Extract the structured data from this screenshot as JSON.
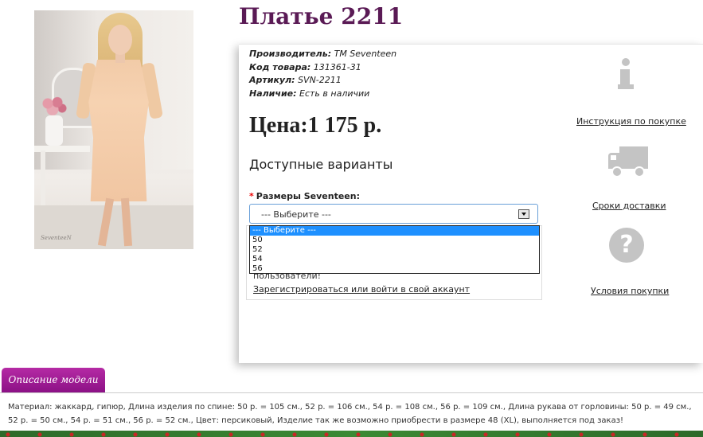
{
  "product": {
    "title": "Платье 2211",
    "photo_signature": "SeventeeN"
  },
  "meta": {
    "manufacturer_label": "Производитель:",
    "manufacturer_value": "ТМ Seventeen",
    "code_label": "Код товара:",
    "code_value": "131361-31",
    "article_label": "Артикул:",
    "article_value": "SVN-2211",
    "stock_label": "Наличие:",
    "stock_value": "Есть в наличии"
  },
  "price": "Цена:1 175 р.",
  "variants_heading": "Доступные варианты",
  "size_select": {
    "required_mark": "*",
    "label": "Размеры Seventeen:",
    "value": "--- Выберите ---",
    "options": [
      "--- Выберите ---",
      "50",
      "52",
      "54",
      "56"
    ]
  },
  "login_box": {
    "note": "пользователи!",
    "link": "Зарегистрироваться или войти в свой аккаунт"
  },
  "side_links": {
    "instruction": "Инструкция по покупке",
    "delivery": "Сроки доставки",
    "terms": "Условия покупки"
  },
  "icons": {
    "instruction": "info-icon",
    "delivery": "truck-icon",
    "terms": "question-icon",
    "select_arrow": "chevron-down-icon"
  },
  "description": {
    "tab_label": "Описание модели",
    "text": "Материал: жаккард, гипюр, Длина изделия по спине: 50 р. = 105 см., 52 р. = 106 см., 54 р. = 108 см., 56 р. = 109 см., Длина рукава от горловины: 50 р. = 49 см., 52 р. = 50 см., 54 р. = 51 см., 56 р. = 52 см., Цвет: персиковый, Изделие так же возможно приобрести в размере 48 (XL), выполняется под заказ!"
  },
  "colors": {
    "title": "#5a1a55",
    "tab": "#9a1a92",
    "selected_option": "#1e90ff"
  }
}
